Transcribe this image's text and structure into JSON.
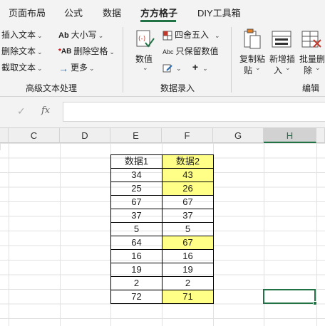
{
  "tabs": [
    {
      "label": "页面布局",
      "active": false
    },
    {
      "label": "公式",
      "active": false
    },
    {
      "label": "数据",
      "active": false
    },
    {
      "label": "方方格子",
      "active": true
    },
    {
      "label": "DIY工具箱",
      "active": false
    }
  ],
  "ribbon": {
    "text_group": {
      "items": [
        "插入文本",
        "删除文本",
        "截取文本"
      ],
      "label": "高级文本处理"
    },
    "case_group": {
      "items": [
        "大小写",
        "删除空格",
        "更多"
      ],
      "icons": [
        "ab-case-icon",
        "ab-space-icon",
        "arrow-right-icon"
      ]
    },
    "entry_group": {
      "numeric_label": "数值",
      "round_label": "四舍五入",
      "keep_label": "只保留数值",
      "label": "数据录入"
    },
    "edit_group": {
      "copy_paste_label_1": "复制粘",
      "copy_paste_label_2": "贴",
      "new_insert_label_1": "新增插",
      "new_insert_label_2": "入",
      "batch_delete_label_1": "批量删",
      "batch_delete_label_2": "除",
      "label": "编辑"
    }
  },
  "formula_bar": {
    "cancel_symbol": "✓",
    "fx_symbol": "fx",
    "value": ""
  },
  "columns": [
    "C",
    "D",
    "E",
    "F",
    "G",
    "H"
  ],
  "selected_column": "H",
  "table": {
    "headers": [
      "数据1",
      "数据2"
    ],
    "rows": [
      {
        "a": "34",
        "b": "43",
        "highlight": true
      },
      {
        "a": "25",
        "b": "26",
        "highlight": true
      },
      {
        "a": "67",
        "b": "67",
        "highlight": false
      },
      {
        "a": "37",
        "b": "37",
        "highlight": false
      },
      {
        "a": "5",
        "b": "5",
        "highlight": false
      },
      {
        "a": "64",
        "b": "67",
        "highlight": true
      },
      {
        "a": "16",
        "b": "16",
        "highlight": false
      },
      {
        "a": "19",
        "b": "19",
        "highlight": false
      },
      {
        "a": "2",
        "b": "2",
        "highlight": false
      },
      {
        "a": "72",
        "b": "71",
        "highlight": true
      }
    ]
  },
  "colors": {
    "accent": "#217346",
    "highlight": "#ffff88"
  }
}
